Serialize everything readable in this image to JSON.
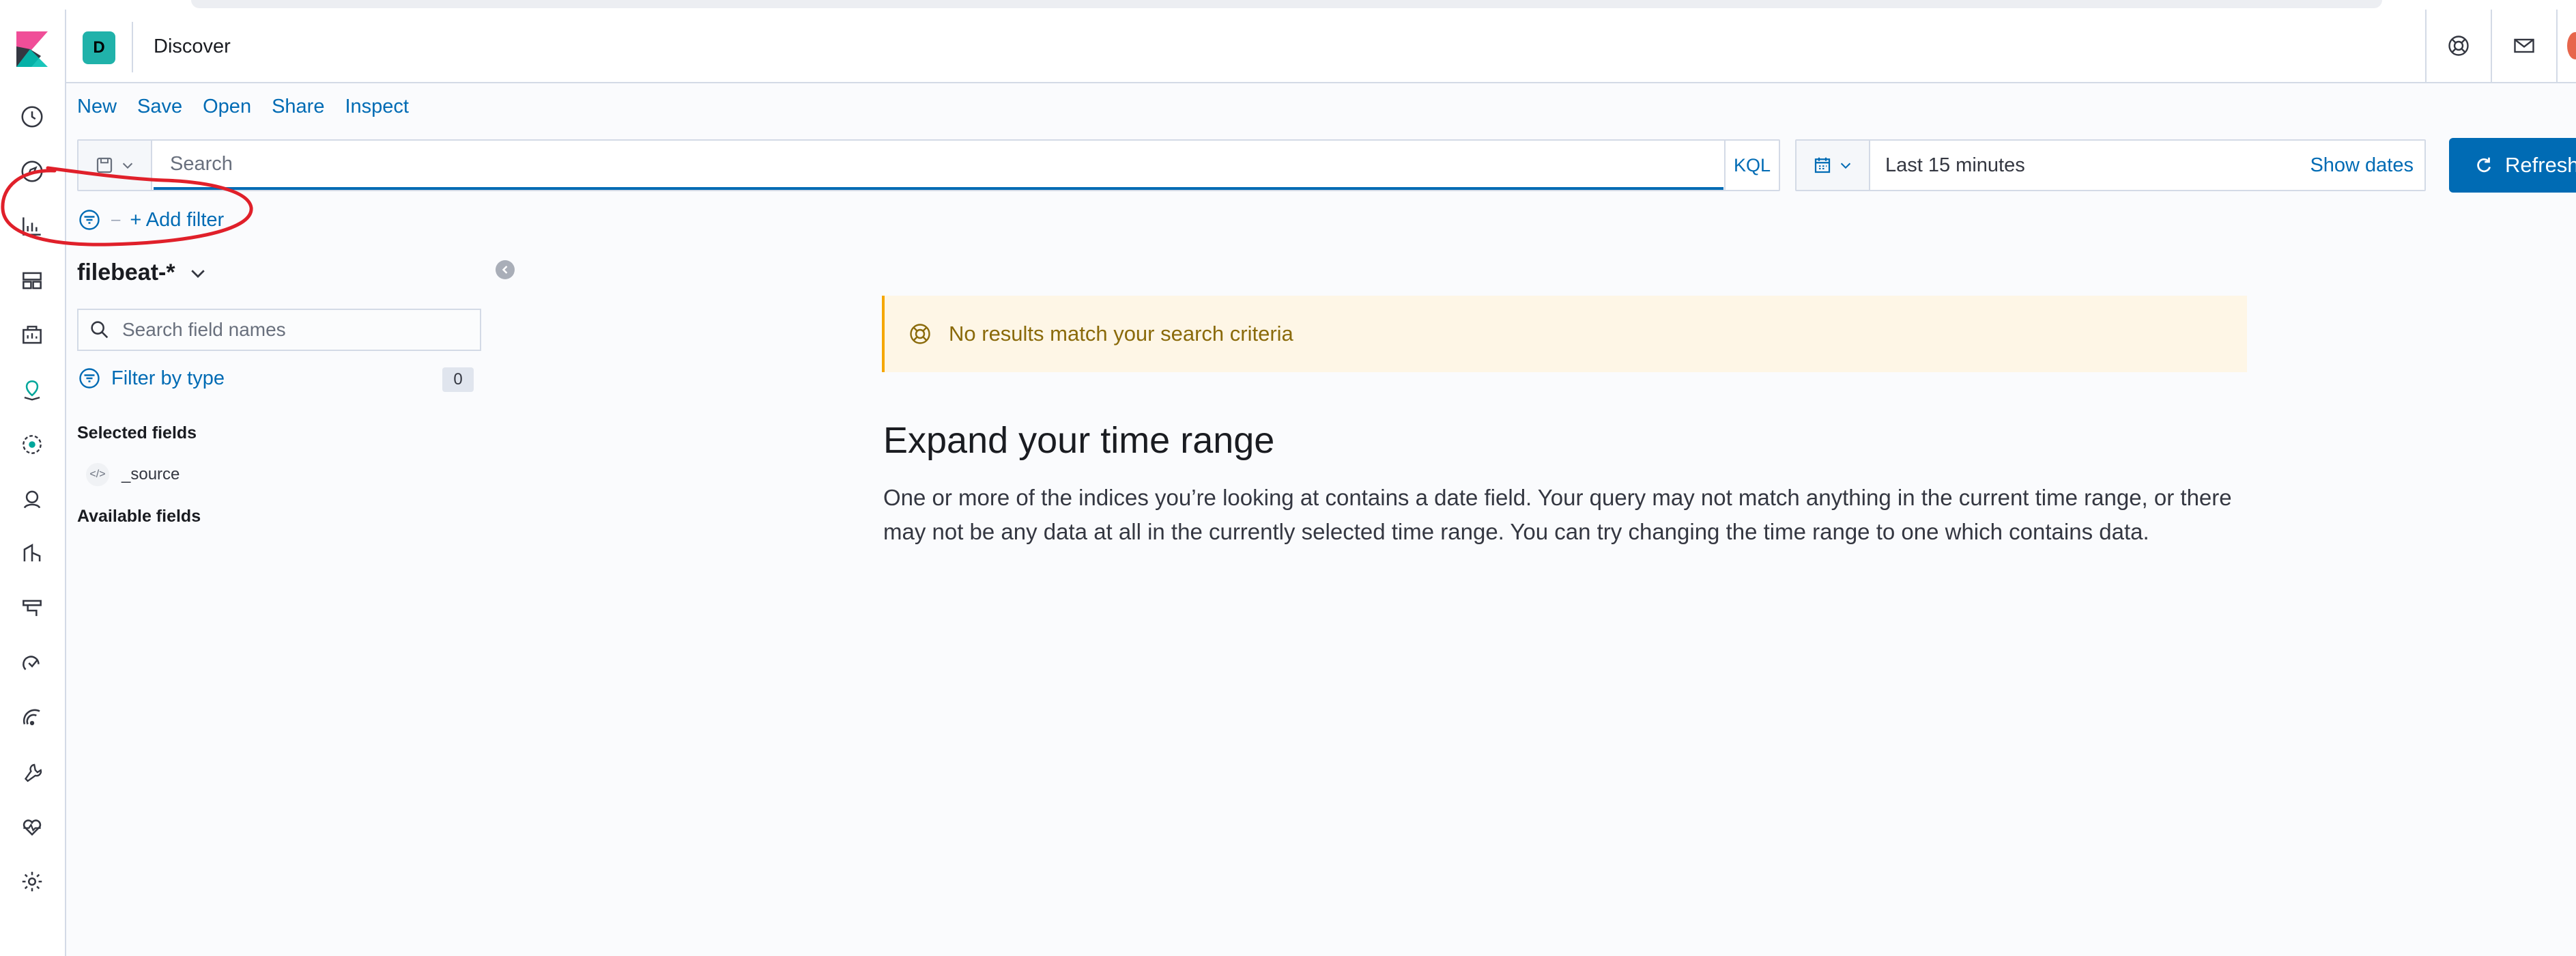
{
  "header": {
    "space_initial": "D",
    "title": "Discover"
  },
  "top_menu": [
    "New",
    "Save",
    "Open",
    "Share",
    "Inspect"
  ],
  "query_bar": {
    "search_placeholder": "Search",
    "language": "KQL"
  },
  "date_picker": {
    "range": "Last 15 minutes",
    "show_dates": "Show dates",
    "refresh_label": "Refresh"
  },
  "filter_bar": {
    "add_filter": "+ Add filter"
  },
  "sidebar": {
    "index_pattern": "filebeat-*",
    "field_search_placeholder": "Search field names",
    "filter_by_type": "Filter by type",
    "type_count": "0",
    "selected_fields_title": "Selected fields",
    "selected_fields": [
      "_source"
    ],
    "available_fields_title": "Available fields"
  },
  "main": {
    "callout": "No results match your search criteria",
    "empty_title": "Expand your time range",
    "empty_body": "One or more of the indices you’re looking at contains a date field. Your query may not match anything in the current time range, or there may not be any data at all in the currently selected time range. You can try changing the time range to one which contains data."
  },
  "colors": {
    "accent": "#006bb4",
    "space_avatar": "#20b2aa",
    "callout_bg": "#fef6e6",
    "callout_border": "#f5a700",
    "annotation": "#e0202a"
  }
}
